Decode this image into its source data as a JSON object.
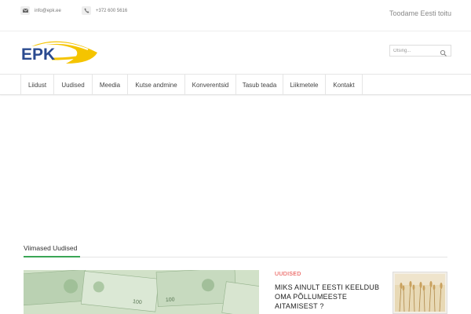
{
  "topbar": {
    "email": "info@epk.ee",
    "phone": "+372 600 5616",
    "tagline": "Toodame Eesti toitu",
    "email_icon": "envelope-icon",
    "phone_icon": "phone-icon"
  },
  "logo": {
    "text": "EPK",
    "color_blue": "#2a4a8f",
    "color_yellow": "#f5c400"
  },
  "search": {
    "placeholder": "Otsing...",
    "icon": "search-icon"
  },
  "nav": {
    "items": [
      {
        "label": "Liidust"
      },
      {
        "label": "Uudised"
      },
      {
        "label": "Meedia"
      },
      {
        "label": "Kutse andmine"
      },
      {
        "label": "Konverentsid"
      },
      {
        "label": "Tasub teada"
      },
      {
        "label": "Liikmetele"
      },
      {
        "label": "Kontakt"
      }
    ]
  },
  "news": {
    "section_title": "Viimased Uudised",
    "accent_color": "#3aa655",
    "item": {
      "category": "UUDISED",
      "category_color": "#e53935",
      "title": "MIKS AINULT EESTI KEELDUB OMA PÕLLUMEESTE AITAMISEST ?"
    }
  }
}
